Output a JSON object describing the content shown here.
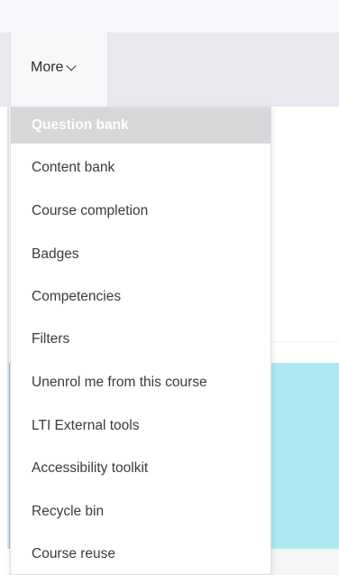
{
  "nav": {
    "more_label": "More"
  },
  "menu": {
    "items": [
      {
        "label": "Question bank",
        "active": true
      },
      {
        "label": "Content bank"
      },
      {
        "label": "Course completion"
      },
      {
        "label": "Badges"
      },
      {
        "label": "Competencies"
      },
      {
        "label": "Filters"
      },
      {
        "label": "Unenrol me from this course"
      },
      {
        "label": "LTI External tools"
      },
      {
        "label": "Accessibility toolkit"
      },
      {
        "label": "Recycle bin"
      },
      {
        "label": "Course reuse"
      }
    ]
  },
  "colors": {
    "active_item_bg": "#d7d7d9",
    "panel_cyan": "#aee8f3"
  }
}
